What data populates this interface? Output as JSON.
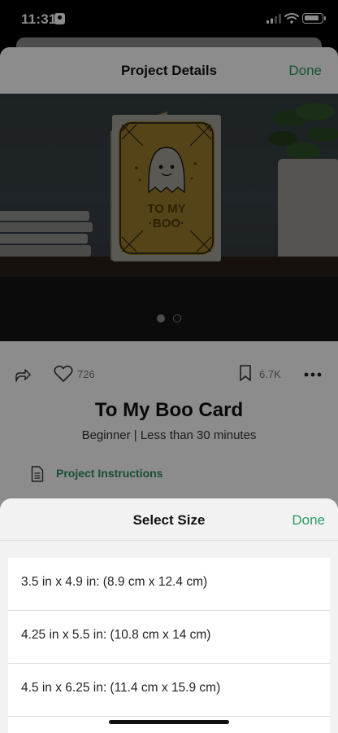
{
  "status_bar": {
    "time": "11:31"
  },
  "colors": {
    "accent": "#2f9a60",
    "text": "#111111"
  },
  "project_details": {
    "title": "Project Details",
    "done_label": "Done",
    "carousel": {
      "pages": 2,
      "active_index": 0
    },
    "likes": "726",
    "saves": "6.7K",
    "project_title": "To My Boo Card",
    "meta": "Beginner | Less than 30 minutes",
    "instructions_label": "Project Instructions",
    "card_text_line1": "TO MY",
    "card_text_line2": "·BOO·",
    "icons": [
      "share-icon",
      "heart-icon",
      "bookmark-icon",
      "more-icon",
      "document-icon"
    ]
  },
  "select_size": {
    "title": "Select Size",
    "done_label": "Done",
    "options": [
      "3.5 in x 4.9 in: (8.9 cm x 12.4 cm)",
      "4.25 in x 5.5 in: (10.8 cm x 14 cm)",
      "4.5 in x 6.25 in: (11.4 cm x 15.9 cm)",
      ""
    ]
  }
}
